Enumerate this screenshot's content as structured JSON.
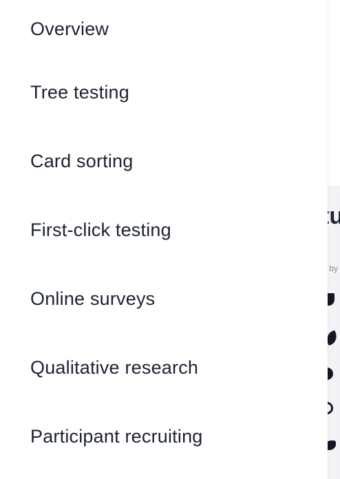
{
  "menu": {
    "items": [
      {
        "label": "Overview"
      },
      {
        "label": "Tree testing"
      },
      {
        "label": "Card sorting"
      },
      {
        "label": "First-click testing"
      },
      {
        "label": "Online surveys"
      },
      {
        "label": "Qualitative research"
      },
      {
        "label": "Participant recruiting"
      }
    ]
  },
  "background": {
    "heading_fragment": "tu",
    "subtext_fragment": "r by"
  }
}
